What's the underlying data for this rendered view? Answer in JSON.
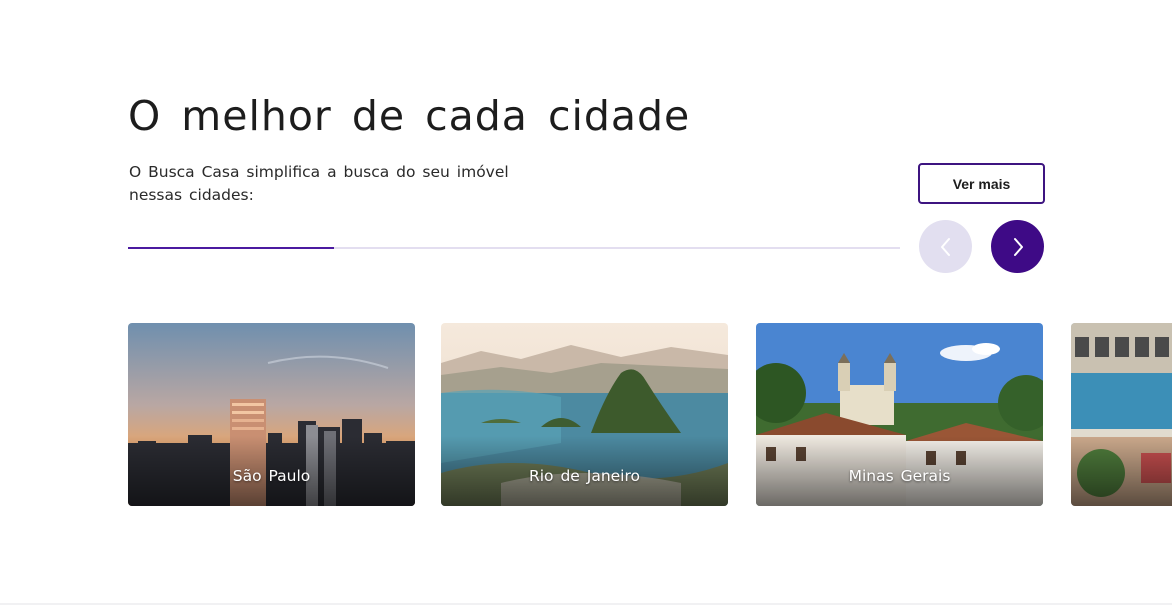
{
  "section": {
    "title": "O melhor de cada cidade",
    "subtitle": "O Busca Casa simplifica a busca do seu imóvel nessas cidades:",
    "see_more_label": "Ver mais"
  },
  "carousel": {
    "progress": 0.267,
    "prev_icon": "chevron-left-icon",
    "next_icon": "chevron-right-icon",
    "cities": [
      {
        "name": "São Paulo"
      },
      {
        "name": "Rio de Janeiro"
      },
      {
        "name": "Minas Gerais"
      },
      {
        "name": ""
      }
    ]
  },
  "colors": {
    "accent": "#3e0a86",
    "accent_light": "#e2dff0",
    "track": "#e3def0"
  }
}
